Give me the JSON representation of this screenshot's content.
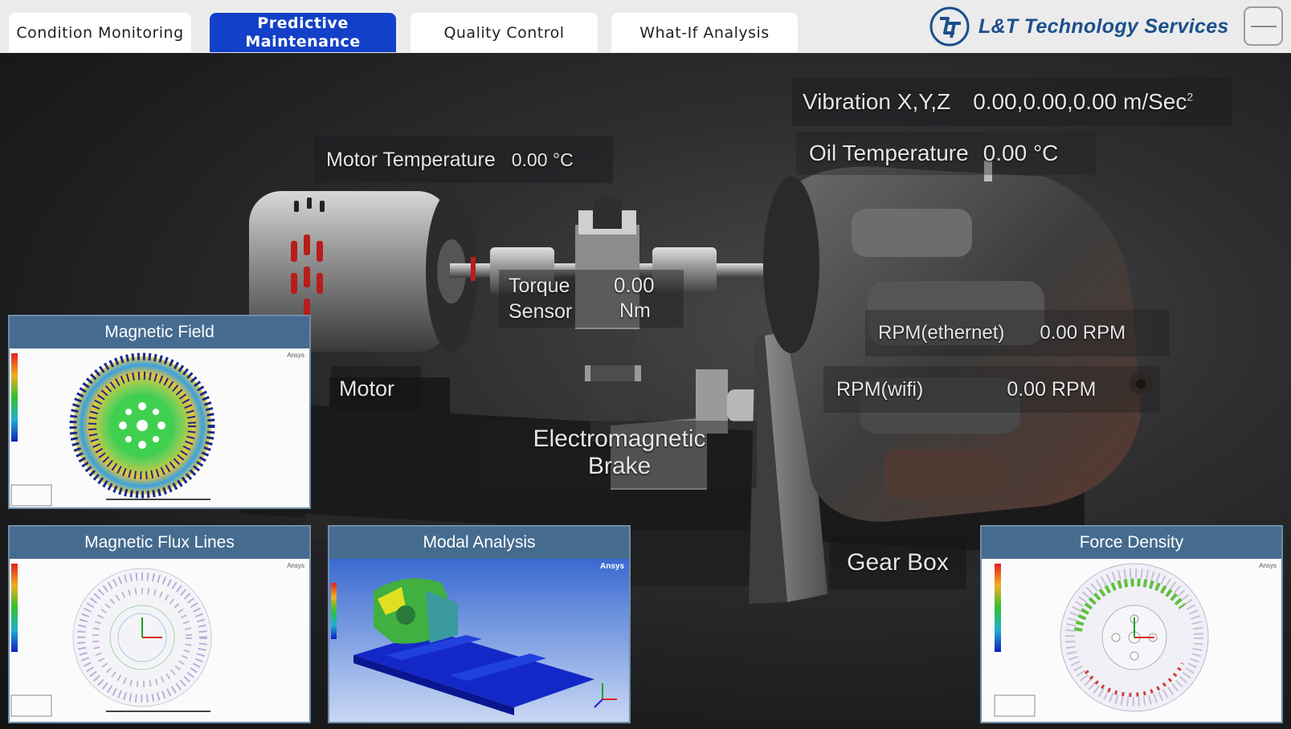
{
  "tabs": [
    {
      "label": "Condition Monitoring",
      "active": false
    },
    {
      "label": "Predictive Maintenance",
      "active": true
    },
    {
      "label": "Quality Control",
      "active": false
    },
    {
      "label": "What-If Analysis",
      "active": false
    }
  ],
  "brand": {
    "name": "L&T Technology Services",
    "color": "#1b4f8c"
  },
  "readouts": {
    "vibration_label": "Vibration X,Y,Z",
    "vibration_value": "0.00,0.00,0.00 m/Sec",
    "vibration_sup": "2",
    "motor_temp_label": "Motor Temperature",
    "motor_temp_value": "0.00 °C",
    "oil_temp_label": "Oil Temperature",
    "oil_temp_value": "0.00 °C",
    "torque_label_1": "Torque",
    "torque_label_2": "Sensor",
    "torque_value": "0.00",
    "torque_unit": "Nm",
    "rpm_eth_label": "RPM(ethernet)",
    "rpm_eth_value": "0.00 RPM",
    "rpm_wifi_label": "RPM(wifi)",
    "rpm_wifi_value": "0.00 RPM"
  },
  "components": {
    "motor": "Motor",
    "brake_1": "Electromagnetic",
    "brake_2": "Brake",
    "gearbox": "Gear Box"
  },
  "panels": {
    "magnetic_field": "Magnetic Field",
    "flux_lines": "Magnetic Flux Lines",
    "modal": "Modal Analysis",
    "force_density": "Force Density",
    "ansys_mark": "Ansys"
  },
  "colors": {
    "accent": "#1340c8",
    "panel_header": "#456b8f"
  }
}
